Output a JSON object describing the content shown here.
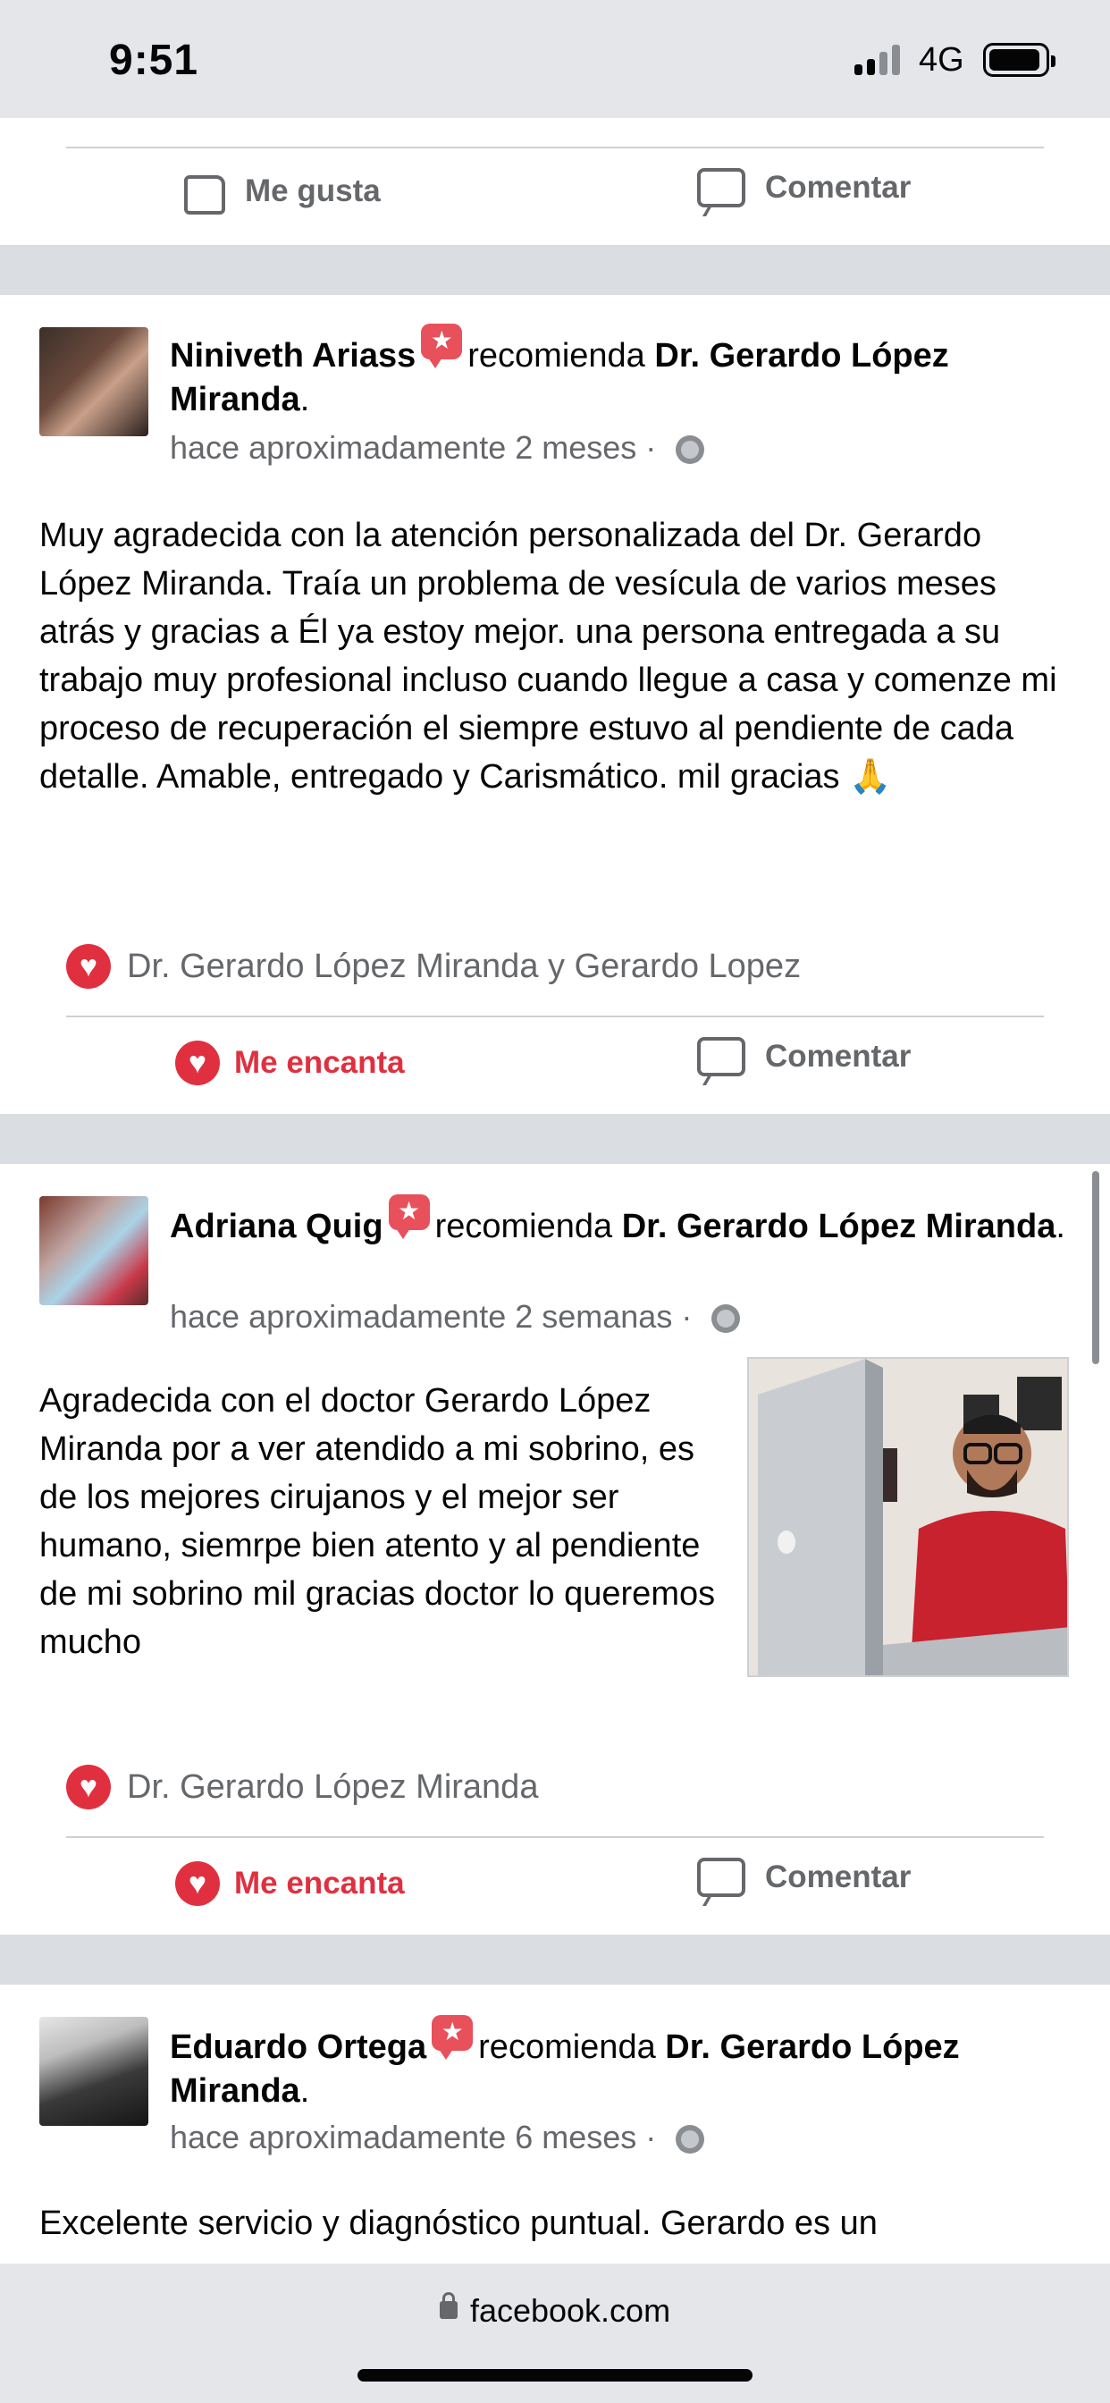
{
  "status_bar": {
    "time": "9:51",
    "network": "4G"
  },
  "top_post": {
    "like_label": "Me gusta",
    "comment_label": "Comentar"
  },
  "posts": [
    {
      "author": "Niniveth Ariass",
      "verb": "recomienda",
      "page": "Dr. Gerardo López Miranda",
      "time": "hace aproximadamente 2 meses · ",
      "text": "Muy agradecida con la atención personalizada del Dr. Gerardo López Miranda. Traía un problema de vesícula de varios meses atrás y gracias a Él ya estoy mejor. una persona entregada a su trabajo muy profesional incluso cuando llegue a casa y comenze mi proceso de recuperación el siempre estuvo al pendiente de cada detalle. Amable, entregado y Carismático. mil gracias 🙏",
      "reactions": "Dr. Gerardo López Miranda y Gerardo Lopez",
      "love_label": "Me encanta",
      "comment_label": "Comentar"
    },
    {
      "author": "Adriana Quig",
      "verb": "recomienda",
      "page": "Dr. Gerardo López Miranda",
      "time": "hace aproximadamente 2 semanas · ",
      "text": "Agradecida con el doctor Gerardo López Miranda por a ver atendido a mi sobrino, es de los mejores cirujanos y el mejor ser humano, siemrpe bien atento y al pendiente de mi sobrino mil gracias doctor lo queremos mucho",
      "reactions": "Dr. Gerardo López Miranda",
      "love_label": "Me encanta",
      "comment_label": "Comentar"
    },
    {
      "author": "Eduardo Ortega",
      "verb": "recomienda",
      "page": "Dr. Gerardo López Miranda",
      "time": "hace aproximadamente 6 meses · ",
      "text": "Excelente servicio y diagnóstico puntual. Gerardo es un"
    }
  ],
  "browser": {
    "url": "facebook.com"
  }
}
